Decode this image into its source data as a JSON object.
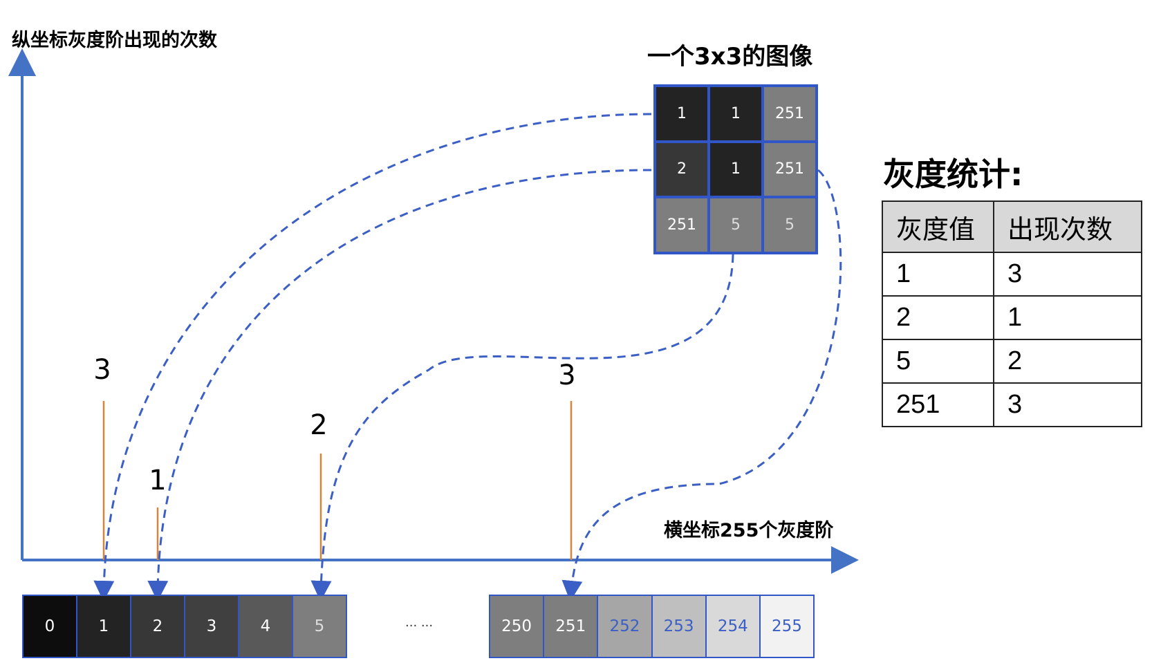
{
  "labels": {
    "y_axis": "纵坐标灰度阶出现的次数",
    "x_axis": "横坐标255个灰度阶",
    "image_title": "一个3x3的图像",
    "stats_title": "灰度统计:",
    "ellipsis": "... ..."
  },
  "image_grid": [
    {
      "value": "1",
      "bg": "#232323",
      "fg": "#ffffff"
    },
    {
      "value": "1",
      "bg": "#232323",
      "fg": "#ffffff"
    },
    {
      "value": "251",
      "bg": "#7e7e7e",
      "fg": "#ffffff"
    },
    {
      "value": "2",
      "bg": "#373737",
      "fg": "#ffffff"
    },
    {
      "value": "1",
      "bg": "#232323",
      "fg": "#ffffff"
    },
    {
      "value": "251",
      "bg": "#7e7e7e",
      "fg": "#ffffff"
    },
    {
      "value": "251",
      "bg": "#7e7e7e",
      "fg": "#ffffff"
    },
    {
      "value": "5",
      "bg": "#7e7e7e",
      "fg": "#dddddd"
    },
    {
      "value": "5",
      "bg": "#7e7e7e",
      "fg": "#dddddd"
    }
  ],
  "gray_bar_left": [
    {
      "value": "0",
      "bg": "#0d0d0d",
      "fg": "#ffffff"
    },
    {
      "value": "1",
      "bg": "#232323",
      "fg": "#ffffff"
    },
    {
      "value": "2",
      "bg": "#373737",
      "fg": "#ffffff"
    },
    {
      "value": "3",
      "bg": "#404040",
      "fg": "#ffffff"
    },
    {
      "value": "4",
      "bg": "#595959",
      "fg": "#ffffff"
    },
    {
      "value": "5",
      "bg": "#7e7e7e",
      "fg": "#dddddd"
    }
  ],
  "gray_bar_right": [
    {
      "value": "250",
      "bg": "#7e7e7e",
      "fg": "#ffffff"
    },
    {
      "value": "251",
      "bg": "#7e7e7e",
      "fg": "#ffffff"
    },
    {
      "value": "252",
      "bg": "#a6a6a6",
      "fg": "#3b5fc4"
    },
    {
      "value": "253",
      "bg": "#bfbfbf",
      "fg": "#3b5fc4"
    },
    {
      "value": "254",
      "bg": "#d9d9d9",
      "fg": "#3b5fc4"
    },
    {
      "value": "255",
      "bg": "#f2f2f2",
      "fg": "#3b5fc4"
    }
  ],
  "histogram_counts": [
    {
      "gray": "1",
      "count": "3"
    },
    {
      "gray": "2",
      "count": "1"
    },
    {
      "gray": "5",
      "count": "2"
    },
    {
      "gray": "251",
      "count": "3"
    }
  ],
  "stats_table": {
    "headers": [
      "灰度值",
      "出现次数"
    ],
    "rows": [
      [
        "1",
        "3"
      ],
      [
        "2",
        "1"
      ],
      [
        "5",
        "2"
      ],
      [
        "251",
        "3"
      ]
    ]
  },
  "colors": {
    "axis": "#4472c4",
    "stem": "#d9823b",
    "grid_border": "#3056c8",
    "dashed": "#3b5fc4"
  }
}
